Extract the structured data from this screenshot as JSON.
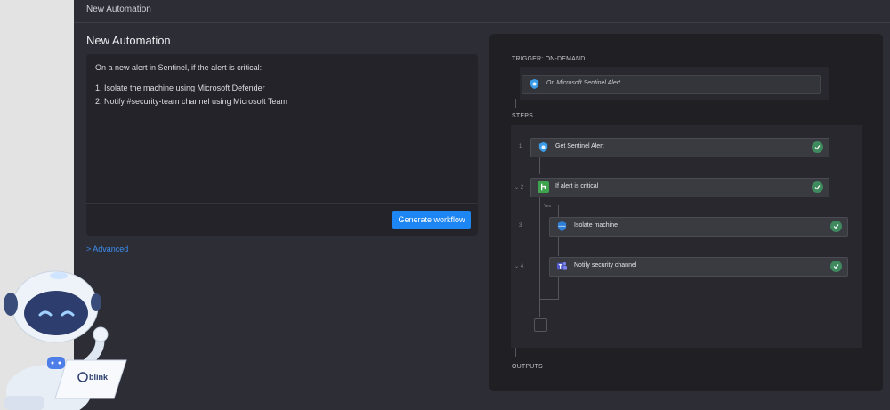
{
  "header": {
    "title": "New Automation"
  },
  "page": {
    "title": "New Automation"
  },
  "prompt": {
    "lines": [
      "On a new alert in Sentinel, if the alert is critical:",
      "1. Isolate the machine using Microsoft Defender",
      "2. Notify #security-team channel using Microsoft Team"
    ],
    "generate_label": "Generate workflow"
  },
  "advanced_label": "> Advanced",
  "workflow": {
    "trigger_label": "TRIGGER: ON-DEMAND",
    "trigger_text": "On Microsoft Sentinel Alert",
    "steps_label": "STEPS",
    "outputs_label": "OUTPUTS",
    "yes_label": "Yes",
    "steps": [
      {
        "num": "1",
        "label": "Get Sentinel Alert",
        "icon": "sentinel-shield-icon"
      },
      {
        "num": "⌄ 2",
        "label": "If alert is critical",
        "icon": "condition-branch-icon"
      },
      {
        "num": "3",
        "label": "Isolate machine",
        "icon": "defender-shield-icon"
      },
      {
        "num": "⌄ 4",
        "label": "Notify security channel",
        "icon": "teams-icon"
      }
    ]
  },
  "mascot": {
    "brand": "blink"
  },
  "colors": {
    "accent": "#1e86f2",
    "success": "#3e8a5e",
    "link": "#3d8df0"
  }
}
